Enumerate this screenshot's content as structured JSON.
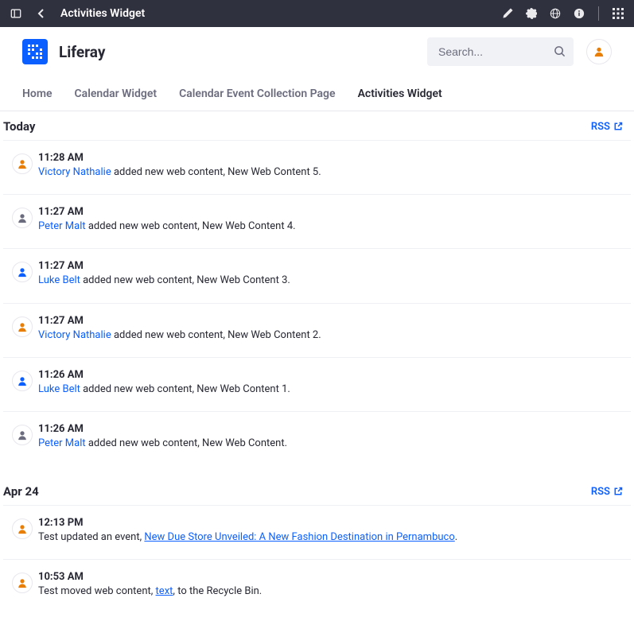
{
  "topbar": {
    "title": "Activities Widget"
  },
  "brand": "Liferay",
  "search": {
    "placeholder": "Search..."
  },
  "nav": {
    "items": [
      {
        "label": "Home"
      },
      {
        "label": "Calendar Widget"
      },
      {
        "label": "Calendar Event Collection Page"
      },
      {
        "label": "Activities Widget"
      }
    ],
    "activeIndex": 3
  },
  "rss_label": "RSS",
  "sections": [
    {
      "day": "Today",
      "activities": [
        {
          "time": "11:28 AM",
          "avatar": "orange",
          "user": "Victory Nathalie",
          "suffix": " added new web content, New Web Content 5."
        },
        {
          "time": "11:27 AM",
          "avatar": "gray",
          "user": "Peter Malt",
          "suffix": " added new web content, New Web Content 4."
        },
        {
          "time": "11:27 AM",
          "avatar": "blue",
          "user": "Luke Belt",
          "suffix": " added new web content, New Web Content 3."
        },
        {
          "time": "11:27 AM",
          "avatar": "orange",
          "user": "Victory Nathalie",
          "suffix": " added new web content, New Web Content 2."
        },
        {
          "time": "11:26 AM",
          "avatar": "blue",
          "user": "Luke Belt",
          "suffix": " added new web content, New Web Content 1."
        },
        {
          "time": "11:26 AM",
          "avatar": "gray",
          "user": "Peter Malt",
          "suffix": " added new web content, New Web Content."
        }
      ]
    },
    {
      "day": "Apr 24",
      "activities": [
        {
          "time": "12:13 PM",
          "avatar": "orange",
          "prefix": "Test updated an event, ",
          "link": "New Due Store Unveiled: A New Fashion Destination in Pernambuco",
          "suffix2": "."
        },
        {
          "time": "10:53 AM",
          "avatar": "orange",
          "prefix": "Test moved web content, ",
          "link": "text",
          "suffix2": ", to the Recycle Bin."
        }
      ]
    }
  ]
}
